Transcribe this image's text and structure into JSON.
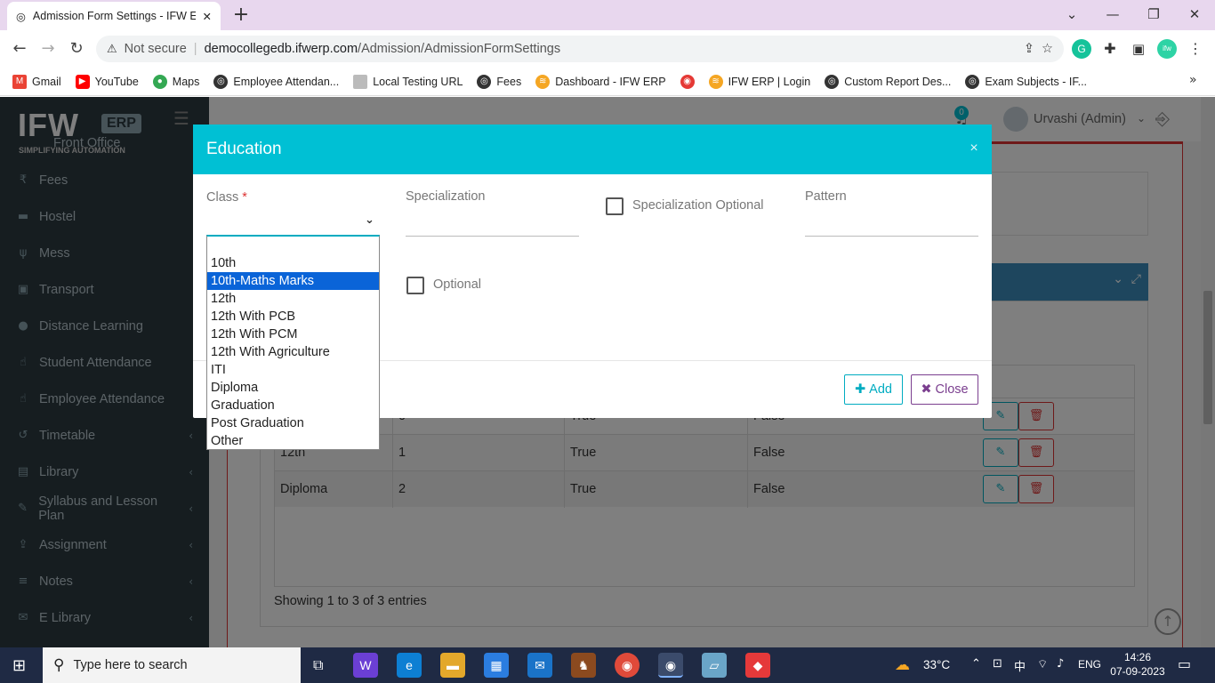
{
  "browser": {
    "tab_title": "Admission Form Settings - IFW E",
    "new_tab": "+",
    "security": "Not secure",
    "url_host": "democollegedb.ifwerp.com",
    "url_path": "/Admission/AdmissionFormSettings"
  },
  "bookmarks": [
    {
      "label": "Gmail",
      "icon": "gmail-icon",
      "color": "#ea4335"
    },
    {
      "label": "YouTube",
      "icon": "youtube-icon",
      "color": "#ff0000"
    },
    {
      "label": "Maps",
      "icon": "maps-icon",
      "color": "#34a853"
    },
    {
      "label": "Employee Attendan...",
      "icon": "globe-icon",
      "color": "#333333"
    },
    {
      "label": "Local Testing URL",
      "icon": "page-icon",
      "color": "#9e9e9e"
    },
    {
      "label": "Fees",
      "icon": "globe-icon",
      "color": "#333333"
    },
    {
      "label": "Dashboard - IFW ERP",
      "icon": "ifw-icon",
      "color": "#f5a623"
    },
    {
      "label": "",
      "icon": "red-circle-icon",
      "color": "#e53935"
    },
    {
      "label": "IFW ERP | Login",
      "icon": "ifw-icon",
      "color": "#f5a623"
    },
    {
      "label": "Custom Report Des...",
      "icon": "globe-icon",
      "color": "#333333"
    },
    {
      "label": "Exam Subjects - IF...",
      "icon": "globe-icon",
      "color": "#333333"
    }
  ],
  "app": {
    "logo_text": "IFW",
    "logo_badge": "ERP",
    "logo_tagline": "SIMPLIFYING AUTOMATION",
    "notification_count": "0",
    "user_name": "Urvashi (Admin)"
  },
  "sidebar": {
    "items": [
      {
        "label": "Front Office",
        "icon": "front-office-icon",
        "chevron": false
      },
      {
        "label": "Fees",
        "icon": "rupee-icon",
        "chevron": false
      },
      {
        "label": "Hostel",
        "icon": "bed-icon",
        "chevron": false
      },
      {
        "label": "Mess",
        "icon": "cutlery-icon",
        "chevron": false
      },
      {
        "label": "Transport",
        "icon": "bus-icon",
        "chevron": false
      },
      {
        "label": "Distance Learning",
        "icon": "globe-icon",
        "chevron": false
      },
      {
        "label": "Student Attendance",
        "icon": "hand-icon",
        "chevron": false
      },
      {
        "label": "Employee Attendance",
        "icon": "hand-icon",
        "chevron": false
      },
      {
        "label": "Timetable",
        "icon": "history-icon",
        "chevron": true
      },
      {
        "label": "Library",
        "icon": "book-icon",
        "chevron": true
      },
      {
        "label": "Syllabus and Lesson Plan",
        "icon": "syllabus-icon",
        "chevron": true
      },
      {
        "label": "Assignment",
        "icon": "upload-icon",
        "chevron": true
      },
      {
        "label": "Notes",
        "icon": "list-icon",
        "chevron": true
      },
      {
        "label": "E Library",
        "icon": "e-library-icon",
        "chevron": true
      }
    ]
  },
  "table": {
    "rows": [
      {
        "name": "",
        "order": "0",
        "c3": "True",
        "c4": "False"
      },
      {
        "name": "12th",
        "order": "1",
        "c3": "True",
        "c4": "False"
      },
      {
        "name": "Diploma",
        "order": "2",
        "c3": "True",
        "c4": "False"
      }
    ],
    "showing": "Showing 1 to 3 of 3 entries"
  },
  "modal": {
    "title": "Education",
    "close_symbol": "×",
    "class_label": "Class",
    "required_mark": "*",
    "specialization_label": "Specialization",
    "specialization_optional_label": "Specialization Optional",
    "pattern_label": "Pattern",
    "optional_label": "Optional",
    "add_label": "Add",
    "close_label": "Close"
  },
  "class_dropdown": {
    "options": [
      "",
      "10th",
      "10th-Maths Marks",
      "12th",
      "12th With PCB",
      "12th With PCM",
      "12th With Agriculture",
      "ITI",
      "Diploma",
      "Graduation",
      "Post Graduation",
      "Other"
    ],
    "highlighted": "10th-Maths Marks"
  },
  "taskbar": {
    "search_placeholder": "Type here to search",
    "weather": "33°C",
    "language": "ENG",
    "time": "14:26",
    "date": "07-09-2023"
  },
  "colors": {
    "modal_header": "#00c0d4",
    "sidebar_bg": "#2c3b41",
    "add_button": "#00acc1",
    "close_button": "#7b3f8f",
    "selected_option": "#0a64d8"
  }
}
